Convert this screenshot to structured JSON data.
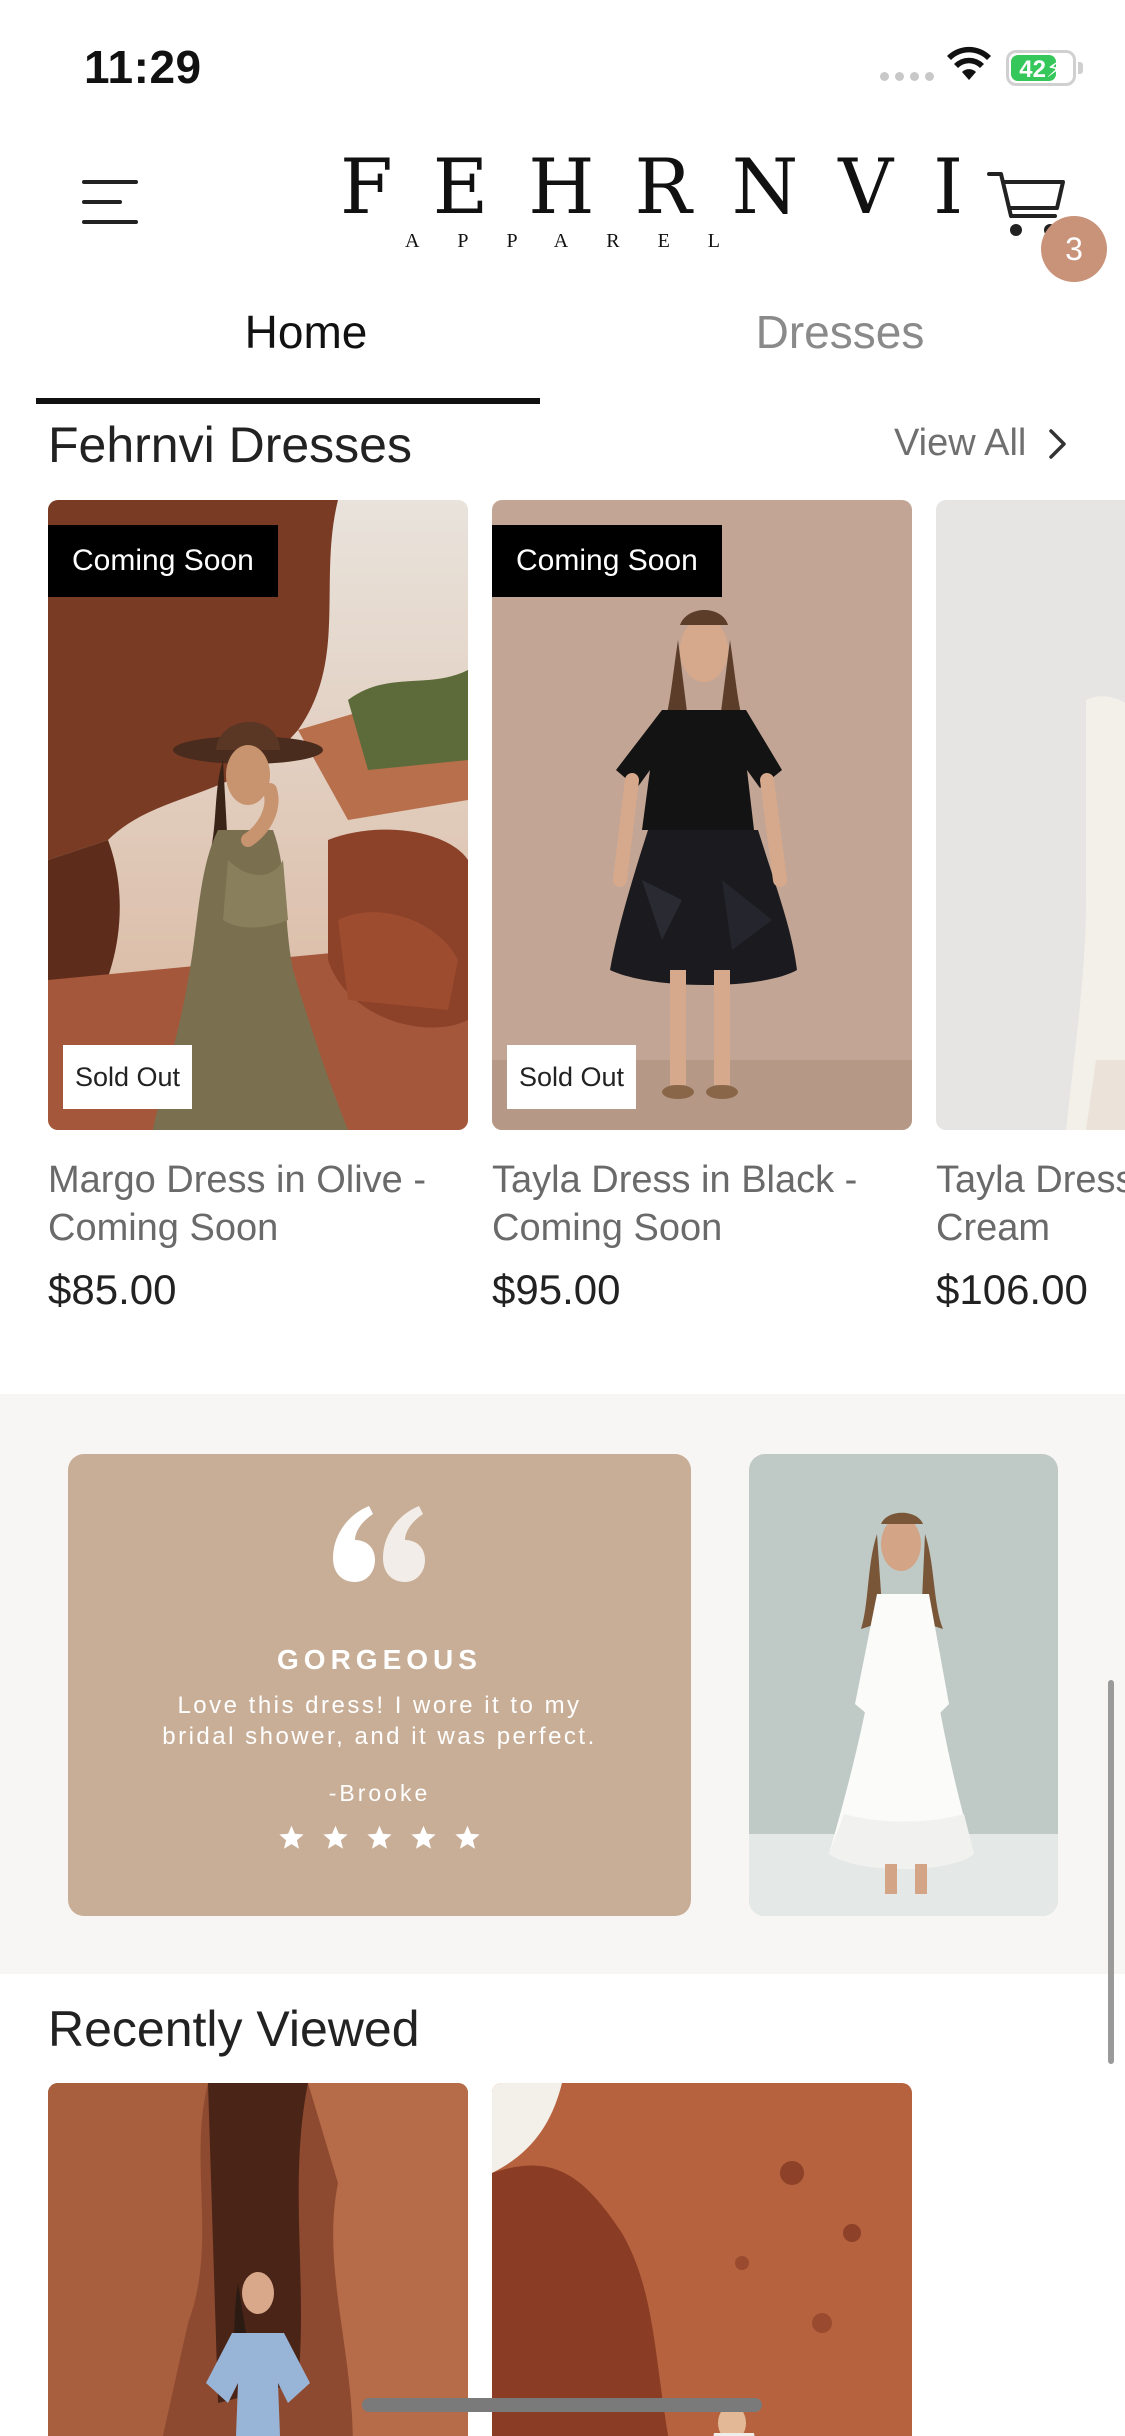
{
  "status_bar": {
    "time": "11:29",
    "battery_percent": 42,
    "battery_label": "42",
    "icons": [
      "signal-icon",
      "wifi-icon",
      "battery-charging-icon"
    ]
  },
  "header": {
    "logo_main": "FEHRNVI",
    "logo_sub": "APPAREL",
    "icons": [
      "menu-icon",
      "cart-icon"
    ],
    "cart_count": "3",
    "colors": {
      "badge": "#c9937a"
    }
  },
  "tabs": [
    {
      "label": "Home",
      "active": true
    },
    {
      "label": "Dresses",
      "active": false
    }
  ],
  "dresses_section": {
    "title": "Fehrnvi Dresses",
    "view_all_label": "View All",
    "products": [
      {
        "name_line1": "Margo Dress in Olive -",
        "name_line2": "Coming Soon",
        "price": "$85.00",
        "top_tag": "Coming Soon",
        "bottom_tag": "Sold Out"
      },
      {
        "name_line1": "Tayla Dress in Black -",
        "name_line2": "Coming Soon",
        "price": "$95.00",
        "top_tag": "Coming Soon",
        "bottom_tag": "Sold Out"
      },
      {
        "name_line1": "Tayla Dress in",
        "name_line2": "Cream",
        "price": "$106.00"
      }
    ]
  },
  "testimonial": {
    "title": "GORGEOUS",
    "line1": "Love this dress! I wore it to my",
    "line2": "bridal shower, and it was perfect.",
    "author": "-Brooke",
    "rating": 5,
    "colors": {
      "card": "#c8ae96"
    }
  },
  "recently_viewed": {
    "title": "Recently Viewed"
  }
}
